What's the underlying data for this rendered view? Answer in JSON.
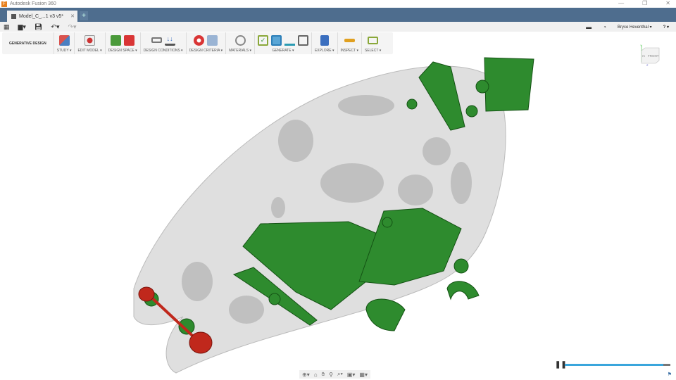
{
  "app": {
    "title": "Autodesk Fusion 360"
  },
  "window": {
    "minimize": "—",
    "restore": "❐",
    "close": "✕"
  },
  "tab": {
    "label": "Model_C_...1 v3 v5*",
    "close": "✕",
    "new": "+"
  },
  "user": {
    "name": "Bryce Heventhal ▾",
    "help": "? ▾"
  },
  "toolbar": {
    "workspace": "GENERATIVE DESIGN",
    "groups": [
      {
        "label": "STUDY ▾",
        "colors": [
          "#d9534f"
        ]
      },
      {
        "label": "EDIT MODEL ▾",
        "colors": [
          "#cc3333"
        ]
      },
      {
        "label": "DESIGN SPACE ▾",
        "colors": [
          "#4a9a3a",
          "#d93535"
        ]
      },
      {
        "label": "DESIGN CONDITIONS ▾",
        "colors": [
          "#777777",
          "#3b6fbf"
        ]
      },
      {
        "label": "DESIGN CRITERIA ▾",
        "colors": [
          "#d93535",
          "#7a9ac0"
        ]
      },
      {
        "label": "MATERIALS ▾",
        "colors": [
          "#888888"
        ]
      },
      {
        "label": "GENERATE ▾",
        "colors": [
          "#8aa83a",
          "#d93535",
          "#2b9bb3",
          "#666666"
        ]
      },
      {
        "label": "EXPLORE ▾",
        "colors": [
          "#3b6fbf"
        ]
      },
      {
        "label": "INSPECT ▾",
        "colors": [
          "#e0a020"
        ]
      },
      {
        "label": "SELECT ▾",
        "colors": [
          "#8aa83a"
        ]
      }
    ]
  },
  "viewcube": {
    "front": "FRONT",
    "side": "RI",
    "axis_y": "Y",
    "axis_z": "Z"
  },
  "timeline": {
    "progress": 0.93
  },
  "colors": {
    "shell": "#c8c8c8",
    "part": "#2e8b2e",
    "obstacle": "#c0281c"
  }
}
